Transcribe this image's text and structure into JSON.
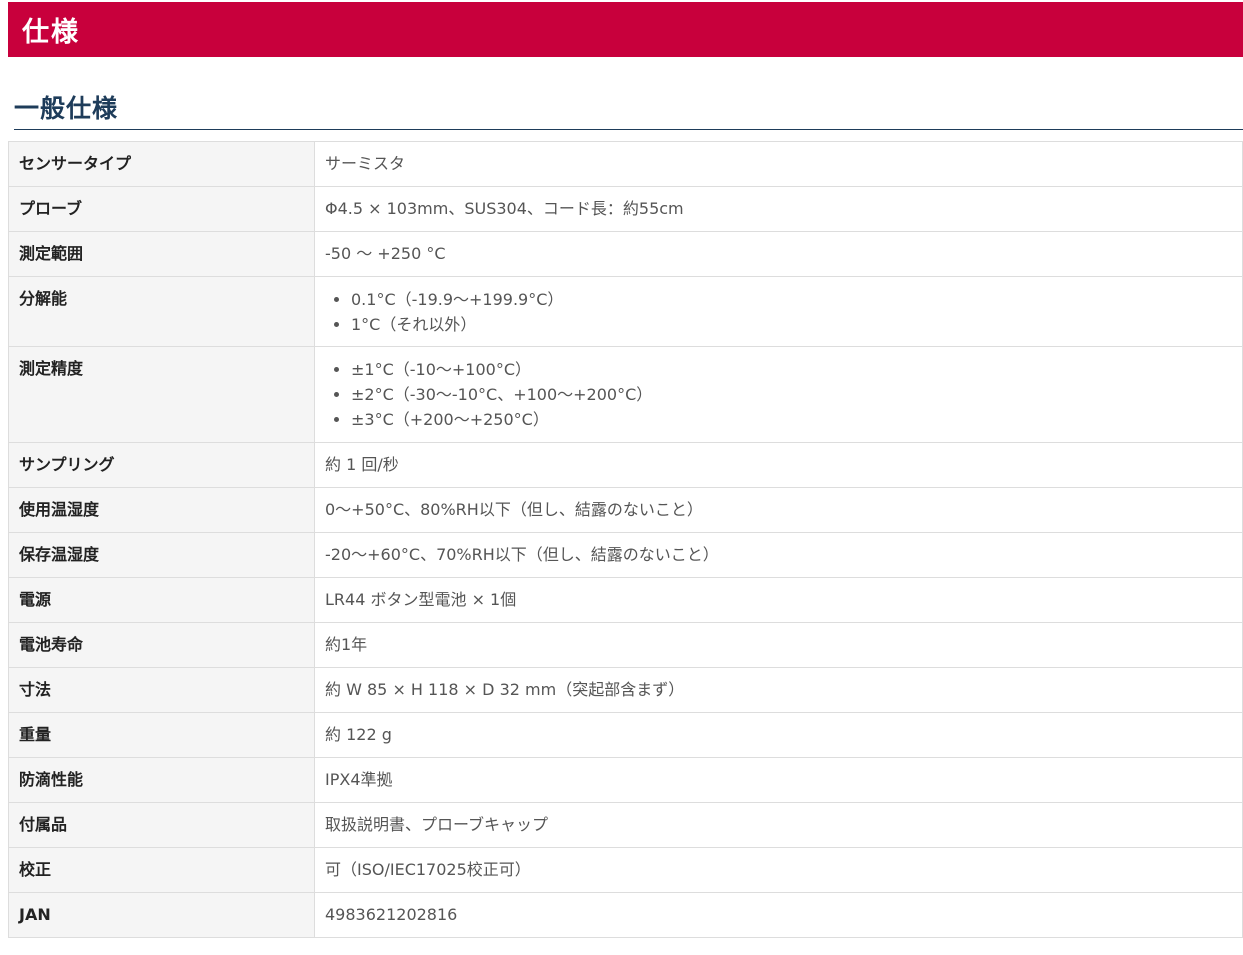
{
  "banner": {
    "title": "仕様"
  },
  "section": {
    "title": "一般仕様"
  },
  "specs": [
    {
      "label": "センサータイプ",
      "value": "サーミスタ"
    },
    {
      "label": "プローブ",
      "value": "Φ4.5 × 103mm、SUS304、コード長：約55cm"
    },
    {
      "label": "測定範囲",
      "value": "-50 ～ +250 °C"
    },
    {
      "label": "分解能",
      "items": [
        "0.1°C（-19.9～+199.9°C）",
        "1°C（それ以外）"
      ]
    },
    {
      "label": "測定精度",
      "items": [
        "±1°C（-10～+100°C）",
        "±2°C（-30～-10°C、+100～+200°C）",
        "±3°C（+200～+250°C）"
      ]
    },
    {
      "label": "サンプリング",
      "value": "約 1 回/秒"
    },
    {
      "label": "使用温湿度",
      "value": "0～+50°C、80%RH以下（但し、結露のないこと）"
    },
    {
      "label": "保存温湿度",
      "value": "-20～+60°C、70%RH以下（但し、結露のないこと）"
    },
    {
      "label": "電源",
      "value": "LR44 ボタン型電池 × 1個"
    },
    {
      "label": "電池寿命",
      "value": "約1年"
    },
    {
      "label": "寸法",
      "value": "約 W 85 × H 118 × D 32 mm（突起部含まず）"
    },
    {
      "label": "重量",
      "value": "約 122 g"
    },
    {
      "label": "防滴性能",
      "value": "IPX4準拠"
    },
    {
      "label": "付属品",
      "value": "取扱説明書、プローブキャップ"
    },
    {
      "label": "校正",
      "value": "可（ISO/IEC17025校正可）"
    },
    {
      "label": "JAN",
      "value": "4983621202816"
    }
  ]
}
